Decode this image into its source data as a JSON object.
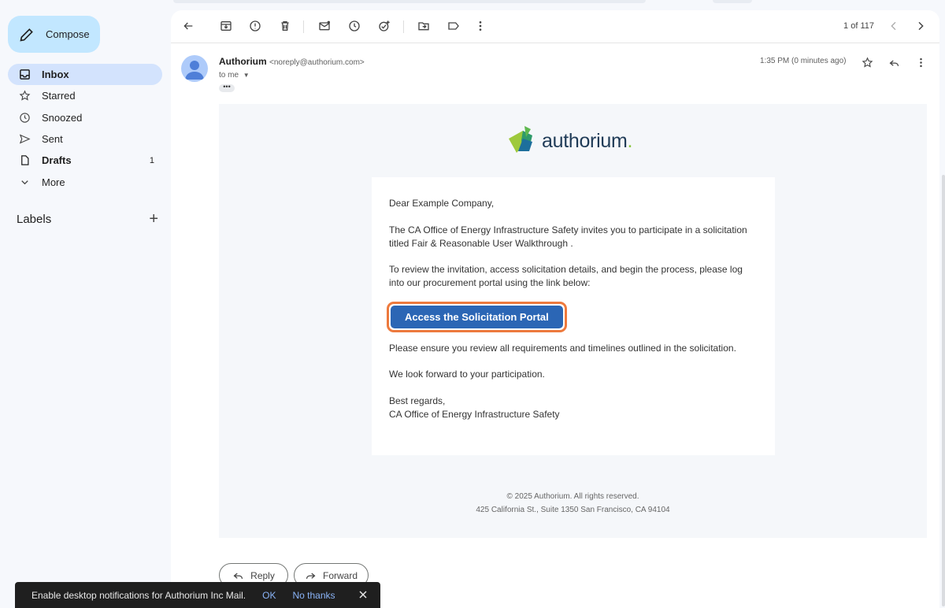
{
  "compose": {
    "label": "Compose",
    "icon": "pencil-icon"
  },
  "sidebar": {
    "items": [
      {
        "label": "Inbox",
        "icon": "inbox-icon",
        "count": ""
      },
      {
        "label": "Starred",
        "icon": "star-icon",
        "count": ""
      },
      {
        "label": "Snoozed",
        "icon": "clock-icon",
        "count": ""
      },
      {
        "label": "Sent",
        "icon": "send-icon",
        "count": ""
      },
      {
        "label": "Drafts",
        "icon": "draft-icon",
        "count": "1"
      },
      {
        "label": "More",
        "icon": "chevron-down-icon",
        "count": ""
      }
    ],
    "labels_heading": "Labels"
  },
  "toolbar": {
    "pager": "1 of 117"
  },
  "message": {
    "sender_name": "Authorium",
    "sender_addr": "<noreply@authorium.com>",
    "to": "to me",
    "time": "1:35 PM (0 minutes ago)"
  },
  "email": {
    "logo_text": "authorium",
    "logo_dot": ".",
    "greeting": "Dear Example Company,",
    "para1": "The CA Office of Energy Infrastructure Safety invites you to participate in a solicitation titled Fair & Reasonable User Walkthrough .",
    "para2": "To review the invitation, access solicitation details, and begin the process, please log into our procurement portal using the link below:",
    "cta": "Access the Solicitation Portal",
    "para3": "Please ensure you review all requirements and timelines outlined in the solicitation.",
    "para4": "We look forward to your participation.",
    "signoff": "Best regards,",
    "signature": "CA Office of Energy Infrastructure Safety",
    "copyright": "© 2025 Authorium. All rights reserved.",
    "address": "425 California St., Suite 1350 San Francisco, CA 94104"
  },
  "actions": {
    "reply": "Reply",
    "forward": "Forward"
  },
  "toast": {
    "message": "Enable desktop notifications for Authorium Inc Mail.",
    "ok": "OK",
    "no_thanks": "No thanks"
  },
  "colors": {
    "accent": "#c2e7ff",
    "active_nav": "#d3e3fd",
    "cta": "#2b66b5",
    "cta_highlight": "#ee7a3d"
  }
}
